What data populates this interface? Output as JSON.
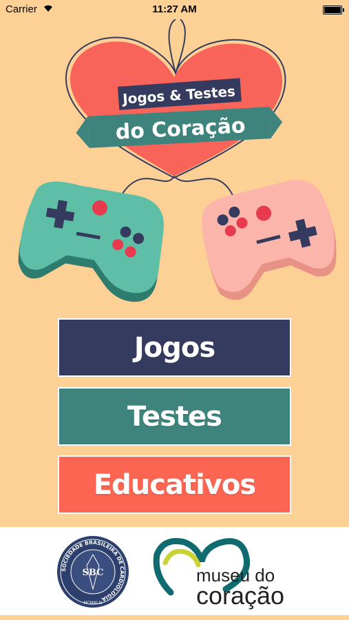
{
  "status_bar": {
    "carrier": "Carrier",
    "time": "11:27 AM"
  },
  "logo": {
    "title_line1": "Jogos & Testes",
    "title_line2": "do Coração"
  },
  "menu": {
    "jogos_label": "Jogos",
    "testes_label": "Testes",
    "educativos_label": "Educativos"
  },
  "footer": {
    "sbc_top_text": "SOCIEDADE BRASILEIRA DE CARDIOLOGIA",
    "sbc_initials": "SBC",
    "sbc_year": "MCMXLIII",
    "museum_line1": "museu do",
    "museum_line2": "coração"
  },
  "colors": {
    "background": "#fdd196",
    "heart": "#f9645a",
    "jogos": "#353b5f",
    "testes": "#3e847d",
    "educativos": "#fb6552",
    "controller_green": "#5fbfa6",
    "controller_pink": "#fbb5aa"
  }
}
